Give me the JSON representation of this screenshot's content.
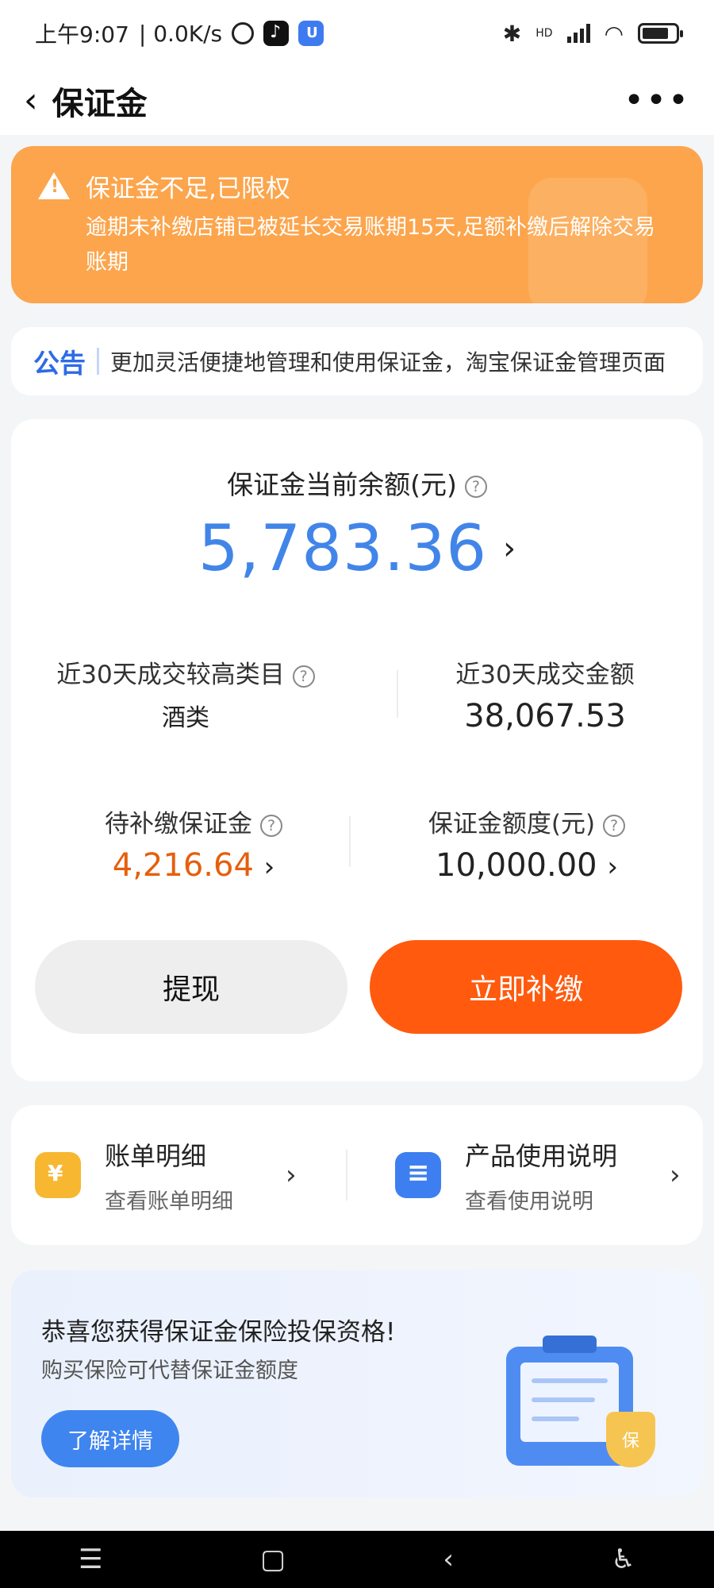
{
  "status_bar": {
    "time": "上午9:07",
    "speed": "| 0.0K/s",
    "hd": "HD"
  },
  "header": {
    "title": "保证金"
  },
  "warning": {
    "title": "保证金不足,已限权",
    "description": "逾期未补缴店铺已被延长交易账期15天,足额补缴后解除交易账期"
  },
  "notice": {
    "tag": "公告",
    "text": "更加灵活便捷地管理和使用保证金，淘宝保证金管理页面"
  },
  "balance": {
    "label": "保证金当前余额(元)",
    "value": "5,783.36"
  },
  "stats": {
    "top_category_label": "近30天成交较高类目",
    "top_category_value": "酒类",
    "amount_label": "近30天成交金额",
    "amount_value": "38,067.53",
    "pending_label": "待补缴保证金",
    "pending_value": "4,216.64",
    "quota_label": "保证金额度(元)",
    "quota_value": "10,000.00"
  },
  "actions": {
    "withdraw": "提现",
    "pay_now": "立即补缴"
  },
  "entries": {
    "bill_title": "账单明细",
    "bill_sub": "查看账单明细",
    "guide_title": "产品使用说明",
    "guide_sub": "查看使用说明"
  },
  "insurance": {
    "title": "恭喜您获得保证金保险投保资格!",
    "subtitle": "购买保险可代替保证金额度",
    "button": "了解详情",
    "shield_text": "保"
  },
  "colors": {
    "warning_bg": "#fca54c",
    "accent_blue": "#4285e9",
    "accent_orange": "#ff5a0e",
    "pending_orange": "#e55f0d"
  }
}
